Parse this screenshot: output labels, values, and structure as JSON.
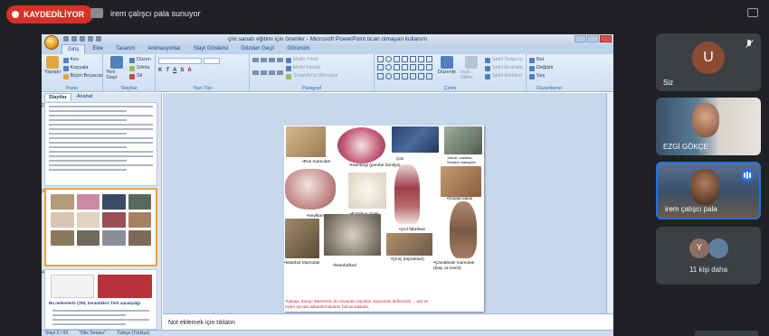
{
  "meet": {
    "recording_label": "KAYDEDİLİYOR",
    "presenter_label": "irem çalışcı pala sunuyor"
  },
  "ppt": {
    "window_title": "çini sanatı eğitimi için öneriler - Microsoft PowerPoint ticari olmayan kullanım",
    "tabs": [
      "Giriş",
      "Ekle",
      "Tasarım",
      "Animasyonlar",
      "Slayt Gösterisi",
      "Gözden Geçir",
      "Görünüm"
    ],
    "ribbon": {
      "clipboard": {
        "paste": "Yapıştır",
        "cut": "Kes",
        "copy": "Kopyala",
        "format_painter": "Biçim Boyacısı",
        "label": "Pano"
      },
      "slides": {
        "new_slide": "Yeni Slayt",
        "layout": "Düzen",
        "reset": "Sıfırla",
        "delete": "Sil",
        "label": "Slaytlar"
      },
      "font": {
        "label": "Yazı Tipi"
      },
      "paragraph": {
        "text_direction": "Metin Yönü",
        "align_text": "Metni Hizala",
        "smartart": "SmartArt'a Dönüştür",
        "label": "Paragraf"
      },
      "drawing": {
        "arrange": "Düzenle",
        "quick_styles": "Hızlı Stiller",
        "shape_fill": "Şekil Dolgusu",
        "shape_outline": "Şekil Anahattı",
        "shape_effects": "Şekil Efektleri",
        "label": "Çizim"
      },
      "editing": {
        "find": "Bul",
        "replace": "Değiştir",
        "select": "Seç",
        "label": "Düzenleme"
      }
    },
    "pane_tabs": [
      "Slaytlar",
      "Anahat"
    ],
    "thumb_numbers": [
      "2",
      "3",
      "4"
    ],
    "thumb4_title": "Bu nedenlerle ÇİNİ, Seramikleri Türk sanatçılığı",
    "slide": {
      "captions": {
        "rus": "•Rus mamulatı",
        "hamanegi": "•Hamangi (pembe familya)",
        "cini": "Çini",
        "jokozi": "Jokozi, varlakar, Seladon kabaçları",
        "seylan": "•Seylkan",
        "kutahya": "•Kütahya çinisi",
        "cini_fabrika": "•Çini fabrikası",
        "galata": "•Galata lalesi",
        "istanbul_mamulati": "•İstanbul Mamulatı",
        "istanbulkari": "•İstanbulkari",
        "cinic": "•Çiniç (topraktan)",
        "canakkale": "•Çanakkale mamulatı (başı at resmi)"
      },
      "footnote": "Topkapı Sarayı Müzesinin bu envanter kayıtları sayesinde defterinde ... adı ve eşleri ayında adlandırmaktadır bulunmaktadır."
    },
    "notes_placeholder": "Not eklemek için tıklatın",
    "status": {
      "slide_count": "Slayt 3 / 63",
      "theme": "\"Ofis Teması\"",
      "language": "Türkçe (Türkiye)"
    }
  },
  "participants": [
    {
      "name": "Siz",
      "initial": "U",
      "color": "#8d4a33"
    },
    {
      "name": "EZGİ GÖKÇE"
    },
    {
      "name": "irem çalışcı pala"
    }
  ],
  "more": {
    "label": "11 kişi daha",
    "initial": "Y"
  }
}
